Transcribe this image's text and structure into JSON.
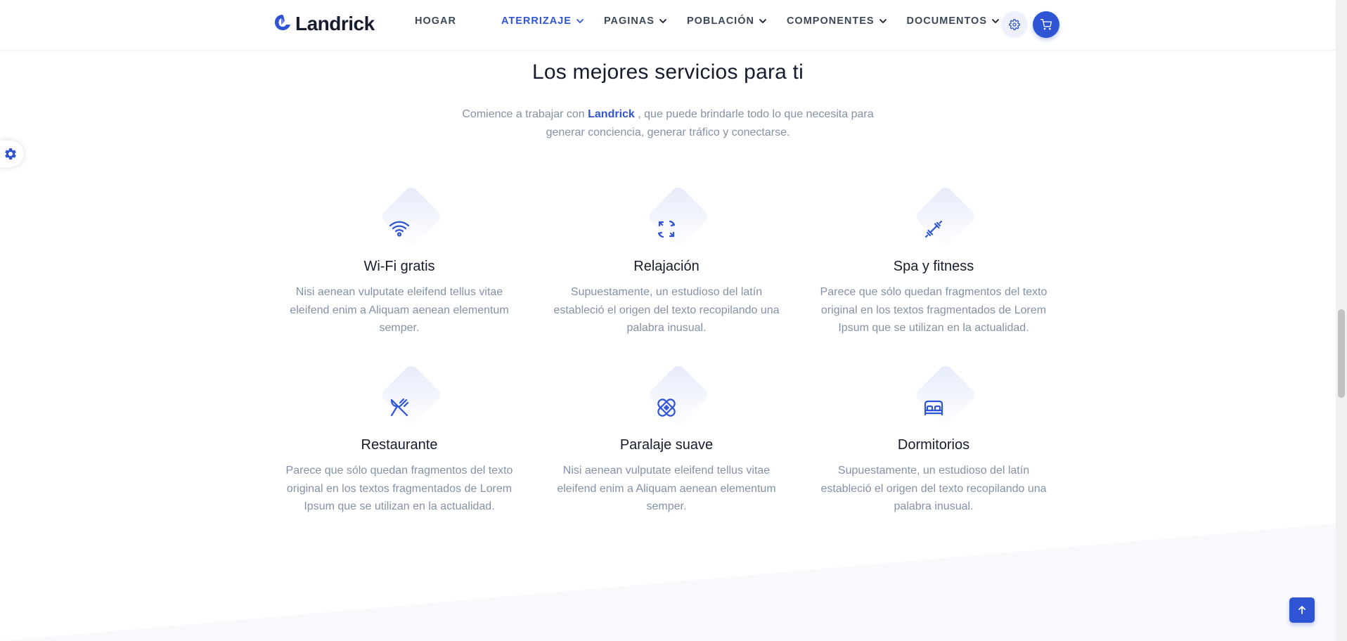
{
  "header": {
    "logo_text": "Landrick",
    "nav": [
      {
        "label": "HOGAR"
      },
      {
        "label": "ATERRIZAJE"
      },
      {
        "label": "PAGINAS"
      },
      {
        "label": "POBLACIÓN"
      },
      {
        "label": "COMPONENTES"
      },
      {
        "label": "DOCUMENTOS"
      }
    ],
    "active_nav": "ATERRIZAJE",
    "settings_icon": "gear-icon",
    "cart_icon": "cart-icon"
  },
  "section": {
    "title": "Los mejores servicios para ti",
    "desc_before": "Comience a trabajar con ",
    "desc_brand": "Landrick",
    "desc_after": " , que puede brindarle todo lo que necesita para generar conciencia, generar tráfico y conectarse."
  },
  "features": [
    {
      "icon": "wifi-icon",
      "title": "Wi-Fi gratis",
      "text": "Nisi aenean vulputate eleifend tellus vitae eleifend enim a Aliquam aenean elementum semper."
    },
    {
      "icon": "refresh-icon",
      "title": "Relajación",
      "text": "Supuestamente, un estudioso del latín estableció el origen del texto recopilando una palabra inusual."
    },
    {
      "icon": "dumbbell-icon",
      "title": "Spa y fitness",
      "text": "Parece que sólo quedan fragmentos del texto original en los textos fragmentados de Lorem Ipsum que se utilizan en la actualidad."
    },
    {
      "icon": "fork-knife-icon",
      "title": "Restaurante",
      "text": "Parece que sólo quedan fragmentos del texto original en los textos fragmentados de Lorem Ipsum que se utilizan en la actualidad."
    },
    {
      "icon": "bandage-icon",
      "title": "Paralaje suave",
      "text": "Nisi aenean vulputate eleifend tellus vitae eleifend enim a Aliquam aenean elementum semper."
    },
    {
      "icon": "bed-icon",
      "title": "Dormitorios",
      "text": "Supuestamente, un estudioso del latín estableció el origen del texto recopilando una palabra inusual."
    }
  ],
  "colors": {
    "primary": "#2f55d4",
    "heading": "#161c2d",
    "muted": "#8492a6",
    "light_bg": "#f8f9fc"
  }
}
